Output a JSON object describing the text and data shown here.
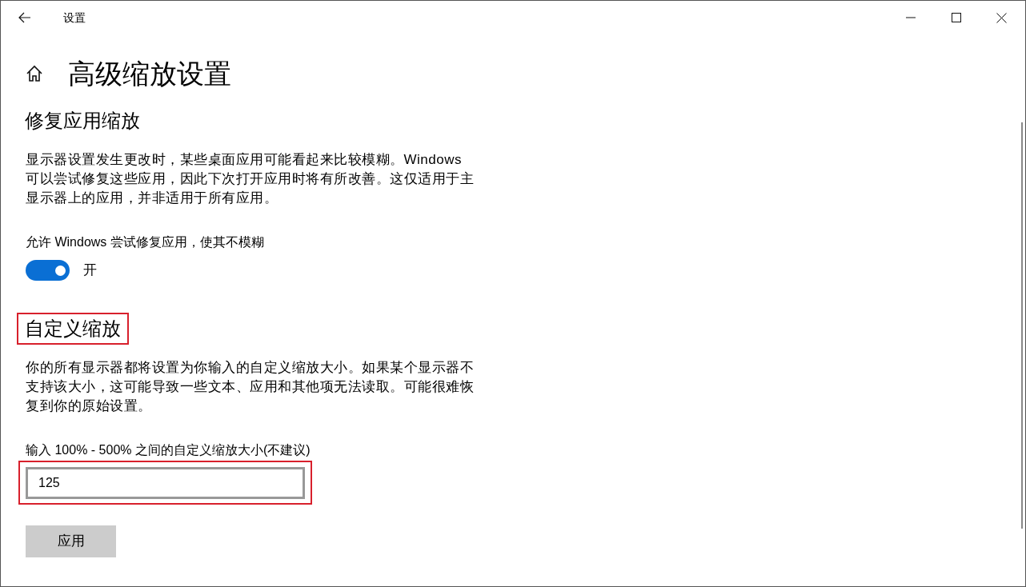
{
  "window": {
    "title": "设置"
  },
  "page_title": "高级缩放设置",
  "sections": [
    {
      "heading": "修复应用缩放",
      "highlighted": false,
      "description": "显示器设置发生更改时，某些桌面应用可能看起来比较模糊。Windows 可以尝试修复这些应用，因此下次打开应用时将有所改善。这仅适用于主显示器上的应用，并非适用于所有应用。",
      "kind": "toggle",
      "label": "允许 Windows 尝试修复应用，使其不模糊",
      "on": true,
      "state_text": "开"
    },
    {
      "heading": "自定义缩放",
      "highlighted": true,
      "description": "你的所有显示器都将设置为你输入的自定义缩放大小。如果某个显示器不支持该大小，这可能导致一些文本、应用和其他项无法读取。可能很难恢复到你的原始设置。",
      "kind": "input",
      "label": "输入 100% - 500% 之间的自定义缩放大小(不建议)",
      "value": "125",
      "field_highlighted": true,
      "button": "应用"
    }
  ]
}
